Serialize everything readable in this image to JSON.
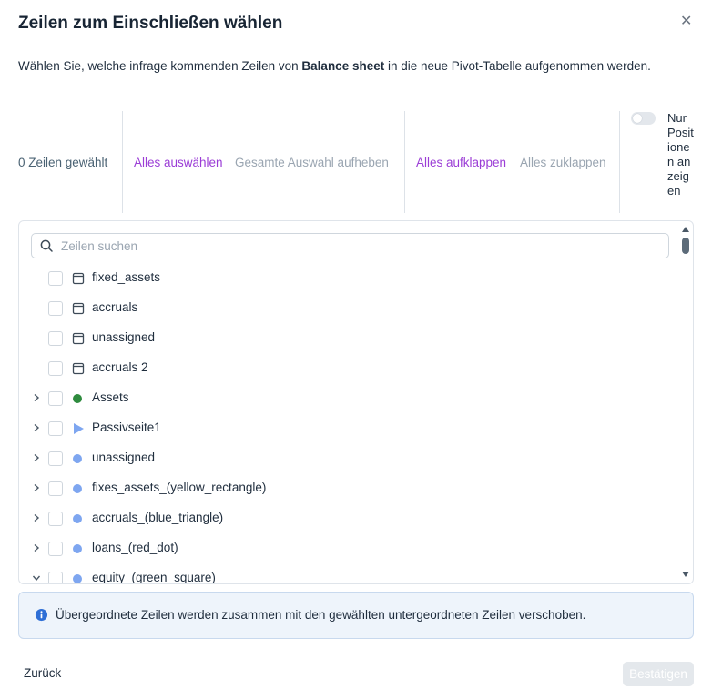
{
  "dialog": {
    "title": "Zeilen zum Einschließen wählen",
    "description_pre": "Wählen Sie, welche infrage kommenden Zeilen von ",
    "description_bold": "Balance sheet",
    "description_post": " in die neue Pivot-Tabelle aufgenommen werden."
  },
  "toolbar": {
    "selected_count": "0 Zeilen gewählt",
    "select_all": "Alles auswählen",
    "clear_selection": "Gesamte Auswahl aufheben",
    "expand_all": "Alles aufklappen",
    "collapse_all": "Alles zuklappen",
    "only_positions_label": "Nur Positionen anzeigen",
    "only_positions_on": false
  },
  "search": {
    "placeholder": "Zeilen suchen",
    "value": ""
  },
  "rows": [
    {
      "label": "fixed_assets",
      "icon": "table-icon",
      "expandable": false
    },
    {
      "label": "accruals",
      "icon": "table-icon",
      "expandable": false
    },
    {
      "label": "unassigned",
      "icon": "table-icon",
      "expandable": false
    },
    {
      "label": "accruals 2",
      "icon": "table-icon",
      "expandable": false
    },
    {
      "label": "Assets",
      "icon": "green-dot-icon",
      "color": "#2e8b3e",
      "expandable": true
    },
    {
      "label": "Passivseite1",
      "icon": "blue-triangle-icon",
      "color": "#7ea6f0",
      "expandable": true
    },
    {
      "label": "unassigned",
      "icon": "blue-dot-icon",
      "color": "#7ea6f0",
      "expandable": true
    },
    {
      "label": "fixes_assets_(yellow_rectangle)",
      "icon": "blue-dot-icon",
      "color": "#7ea6f0",
      "expandable": true
    },
    {
      "label": "accruals_(blue_triangle)",
      "icon": "blue-dot-icon",
      "color": "#7ea6f0",
      "expandable": true
    },
    {
      "label": "loans_(red_dot)",
      "icon": "blue-dot-icon",
      "color": "#7ea6f0",
      "expandable": true
    },
    {
      "label": "equity_(green_square)",
      "icon": "blue-dot-icon",
      "color": "#7ea6f0",
      "expandable": true,
      "expanded": true
    }
  ],
  "info": {
    "text": "Übergeordnete Zeilen werden zusammen mit den gewählten untergeordneten Zeilen verschoben."
  },
  "footer": {
    "back_label": "Zurück",
    "confirm_label": "Bestätigen"
  }
}
